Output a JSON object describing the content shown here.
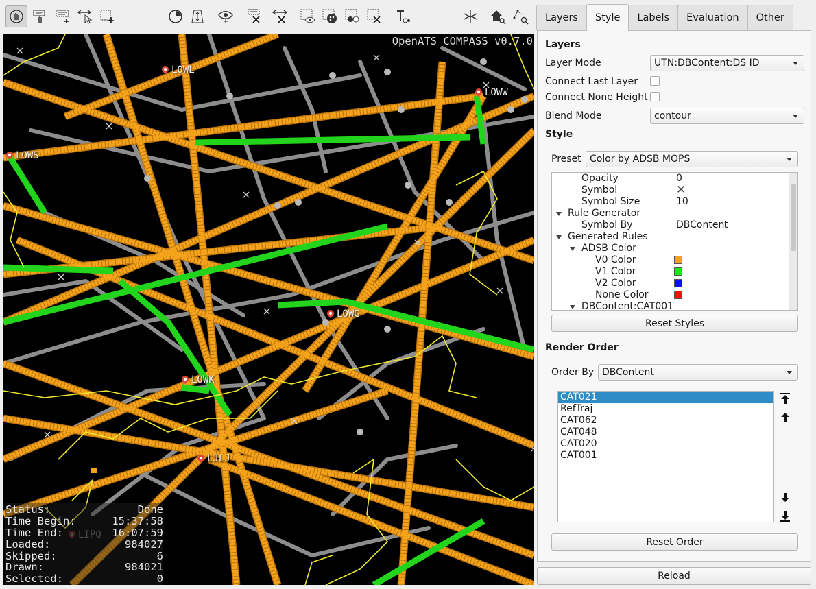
{
  "toolbar": {
    "buttons": [
      {
        "name": "navigate-tool",
        "icon": "hand-navigate-icon",
        "active": true
      },
      {
        "name": "label-tool",
        "icon": "label-hand-icon",
        "active": false
      },
      {
        "name": "select-add-tool",
        "icon": "select-rect-add-icon",
        "active": false
      },
      {
        "name": "measure-tool",
        "icon": "arrow-select-icon",
        "active": false
      },
      {
        "name": "rect-select-tool",
        "icon": "rect-select-plus-icon",
        "active": false
      },
      {
        "name": "time-tool",
        "icon": "clock-icon",
        "active": false
      },
      {
        "name": "height-tool",
        "icon": "height-trapezoid-icon",
        "active": false
      },
      {
        "name": "eye-filter-tool",
        "icon": "eye-icon",
        "active": false
      },
      {
        "name": "clear-labels-tool",
        "icon": "list-clear-icon",
        "active": false
      },
      {
        "name": "clear-measure-tool",
        "icon": "arrows-clear-icon",
        "active": false
      },
      {
        "name": "show-selected-tool",
        "icon": "select-eye-icon",
        "active": false
      },
      {
        "name": "style-selected-tool",
        "icon": "select-palette-icon",
        "active": false
      },
      {
        "name": "invert-selection-tool",
        "icon": "select-invert-icon",
        "active": false
      },
      {
        "name": "clear-selection-tool",
        "icon": "select-clear-icon",
        "active": false
      },
      {
        "name": "text-style-tool",
        "icon": "text-style-icon",
        "active": false
      },
      {
        "name": "axis-tool",
        "icon": "axis-3d-icon",
        "active": false
      },
      {
        "name": "home-zoom-tool",
        "icon": "home-zoom-icon",
        "active": false
      },
      {
        "name": "fit-zoom-tool",
        "icon": "fit-zoom-icon",
        "active": false
      }
    ]
  },
  "map": {
    "title": "OpenATS COMPASS v0.7.0",
    "airports": [
      "LOWL",
      "LOWW",
      "LOWS",
      "LOWG",
      "LOWK",
      "LJLJ",
      "LIPQ"
    ],
    "status": [
      {
        "label": "Status:",
        "value": "Done"
      },
      {
        "label": "Time Begin:",
        "value": "15:37:58"
      },
      {
        "label": "Time End:",
        "value": "16:07:59"
      },
      {
        "label": "Loaded:",
        "value": "984027"
      },
      {
        "label": "Skipped:",
        "value": "6"
      },
      {
        "label": "Drawn:",
        "value": "984021"
      },
      {
        "label": "Selected:",
        "value": "0"
      }
    ]
  },
  "tabs": [
    "Layers",
    "Style",
    "Labels",
    "Evaluation",
    "Other"
  ],
  "active_tab": "Style",
  "layers": {
    "header": "Layers",
    "layer_mode_label": "Layer Mode",
    "layer_mode_value": "UTN:DBContent:DS ID",
    "connect_last_label": "Connect Last Layer",
    "connect_last_checked": false,
    "connect_none_label": "Connect None Height",
    "connect_none_checked": false,
    "blend_mode_label": "Blend Mode",
    "blend_mode_value": "contour"
  },
  "style": {
    "header": "Style",
    "preset_label": "Preset",
    "preset_value": "Color by ADSB MOPS",
    "tree": [
      {
        "key": "Opacity",
        "value": "0",
        "indent": 2,
        "expand": false
      },
      {
        "key": "Symbol",
        "value": "✕",
        "indent": 2,
        "expand": false
      },
      {
        "key": "Symbol Size",
        "value": "10",
        "indent": 2,
        "expand": false
      },
      {
        "key": "Rule Generator",
        "value": "",
        "indent": 1,
        "expand": true
      },
      {
        "key": "Symbol By",
        "value": "DBContent",
        "indent": 2,
        "expand": false
      },
      {
        "key": "Generated Rules",
        "value": "",
        "indent": 1,
        "expand": true
      },
      {
        "key": "ADSB Color",
        "value": "",
        "indent": 2,
        "expand": true
      },
      {
        "key": "V0 Color",
        "value": "",
        "indent": 3,
        "expand": false,
        "color": "#f5a31a"
      },
      {
        "key": "V1 Color",
        "value": "",
        "indent": 3,
        "expand": false,
        "color": "#16e81b"
      },
      {
        "key": "V2 Color",
        "value": "",
        "indent": 3,
        "expand": false,
        "color": "#0a10f2"
      },
      {
        "key": "None Color",
        "value": "",
        "indent": 3,
        "expand": false,
        "color": "#f21010"
      },
      {
        "key": "DBContent:CAT001",
        "value": "",
        "indent": 2,
        "expand": true
      }
    ],
    "reset_styles": "Reset Styles"
  },
  "render_order": {
    "header": "Render Order",
    "order_by_label": "Order By",
    "order_by_value": "DBContent",
    "items": [
      "CAT021",
      "RefTraj",
      "CAT062",
      "CAT048",
      "CAT020",
      "CAT001"
    ],
    "selected": "CAT021",
    "reset_order": "Reset Order"
  },
  "reload": "Reload",
  "colors": {
    "track": "#f5a31a",
    "track_edge": "#b8720e",
    "adsb_v1": "#22d41c",
    "grey_track": "#8a8a8a",
    "border": "#f0e830",
    "selection": "#308cc6"
  }
}
